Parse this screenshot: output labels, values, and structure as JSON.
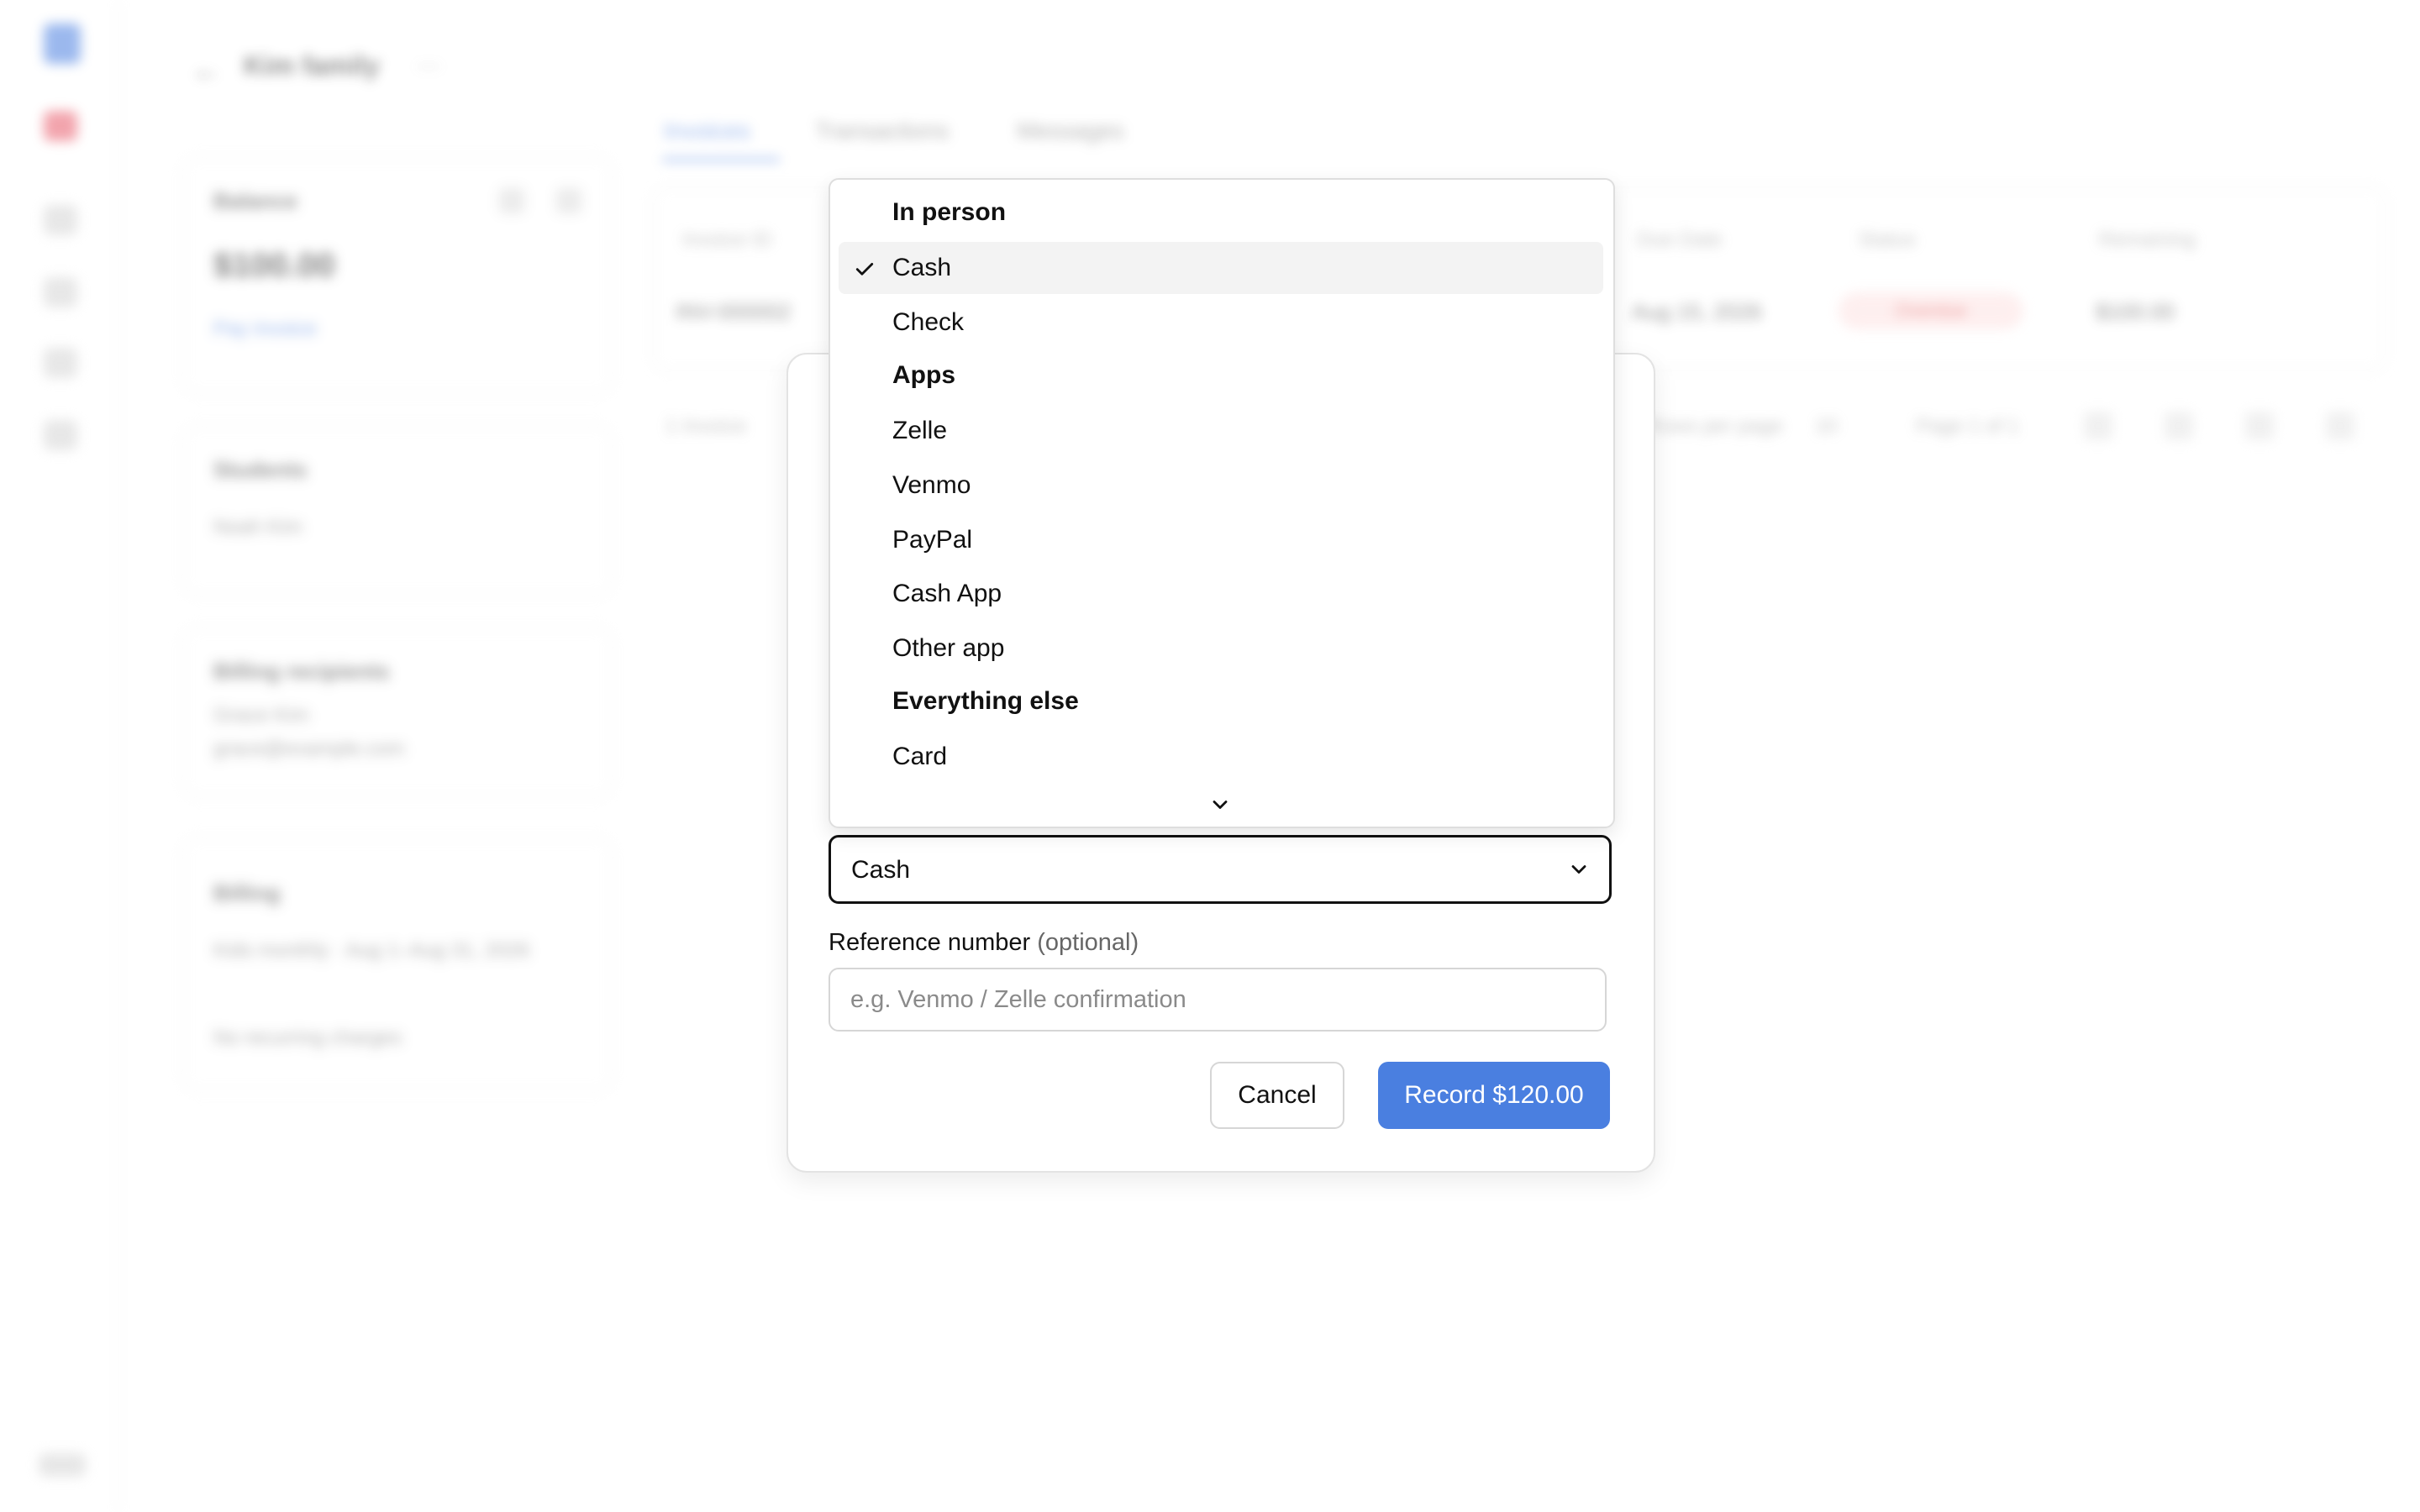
{
  "background": {
    "family_title": "Kim family",
    "balance_card": {
      "title": "Balance",
      "amount": "$100.00",
      "link": "Pay invoice"
    },
    "students_card": {
      "title": "Students",
      "item": "Noah Kim"
    },
    "billing_recipients_card": {
      "title": "Billing recipients",
      "name": "Grace Kim",
      "email": "grace@example.com"
    },
    "billing_card": {
      "title": "Billing",
      "plan": "Kids monthly · Aug 1–Aug 31, 2026",
      "note": "No recurring charges"
    },
    "tabs": [
      "Invoices",
      "Transactions",
      "Messages"
    ],
    "table": {
      "headers": [
        "Invoice ID",
        "Due Date",
        "Status",
        "Remaining"
      ],
      "row": {
        "invoice_id": "INV-000002",
        "due_date": "Aug 15, 2026",
        "status": "Overdue",
        "remaining": "$100.00"
      },
      "footer_count": "1 Invoice",
      "rows_per_page_label": "Rows per page",
      "rows_per_page": "10",
      "page_info": "Page 1 of 1"
    }
  },
  "dialog": {
    "payment_method": {
      "selected_value": "Cash",
      "groups": [
        {
          "label": "In person",
          "options": [
            "Cash",
            "Check"
          ]
        },
        {
          "label": "Apps",
          "options": [
            "Zelle",
            "Venmo",
            "PayPal",
            "Cash App",
            "Other app"
          ]
        },
        {
          "label": "Everything else",
          "options": [
            "Card"
          ]
        }
      ]
    },
    "reference": {
      "label": "Reference number",
      "optional": "(optional)",
      "placeholder": "e.g. Venmo / Zelle confirmation",
      "value": ""
    },
    "cancel_label": "Cancel",
    "record_label": "Record $120.00"
  },
  "colors": {
    "accent": "#4a7fe0",
    "selected_row_bg": "#f3f3f3"
  },
  "icons": {
    "check": "check-icon",
    "chevron": "chevron-down-icon"
  }
}
